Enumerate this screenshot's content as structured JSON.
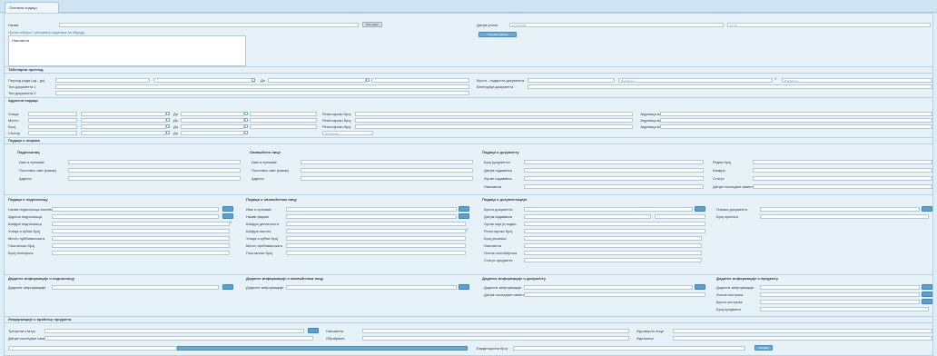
{
  "tab_label": "Основни подаци",
  "top": {
    "left_label": "Назив",
    "search_btn": "Претражи",
    "link_text": "Путем избора / уношења података за обраду",
    "textarea_text": "Напомена",
    "right_label": "Датум уноса",
    "right_value": "12.04.2018",
    "right_small": "10:15",
    "blue_btn": "Сачувај податке"
  },
  "tabular": {
    "title": "Табеларни преглед",
    "row1": "Период рада (од - до)",
    "mid_label": "До",
    "row2": "Тип документа 1",
    "row3": "Тип документа 2",
    "right1": "Врста - подврста документа",
    "right2": "Категорија документа",
    "ph_a": "Изаберите...",
    "ph_b": "Изаберите..."
  },
  "address": {
    "title": "Адресни подаци",
    "rows": [
      "Улица",
      "Место",
      "Број",
      "Сектор"
    ],
    "mid": "До",
    "reg_label": "Регистарски број",
    "right_label": "Јединица мере",
    "extra_ph": "Напомена..."
  },
  "columns": {
    "title": "Подаци о лицима",
    "c1": {
      "title": "Подносилац",
      "rows": [
        "Име и презиме",
        "Пословно име (назив)",
        "Адреса"
      ]
    },
    "c2": {
      "title": "Овлашћено лице",
      "rows": [
        "Име и презиме",
        "Пословно име (назив)",
        "Адреса"
      ]
    },
    "c3": {
      "title": "Подаци о документу",
      "rows": [
        "Број документа",
        "Датум издавања",
        "Орган издавања",
        "Напомена"
      ]
    },
    "c4": {
      "rows": [
        "Редни број",
        "Шифра",
        "Статус",
        "Датум последње измене"
      ]
    }
  },
  "lower": {
    "l1": {
      "title": "Подаци о подносиоцу",
      "rows": [
        "Назив подносиоца захтева",
        "Адреса подносиоца",
        "Шифра подносиоца",
        "Улица и кућни број",
        "Место пребивалишта",
        "Поштански број",
        "Број телефона"
      ]
    },
    "l2": {
      "title": "Подаци о овлашћеном лицу",
      "rows": [
        "Име и презиме",
        "Назив фирме",
        "Шифра делатности",
        "Шифра налога",
        "Улица и кућни број",
        "Место пребивалишта",
        "Поштански број"
      ]
    },
    "l3": {
      "title": "Подаци о документацији",
      "rows": [
        "Врста документа",
        "Датум издавања",
        "Орган који је издао",
        "Регистарски број",
        "Број решења",
        "Напомена",
        "Основ ослобођења",
        "Статус предмета"
      ]
    },
    "l4": {
      "rows": [
        "Ознака документа",
        "Број прилога"
      ]
    }
  },
  "bottom_sections": {
    "s1": {
      "title": "Додатне информације о подносиоцу",
      "row": "Додатне информације"
    },
    "s2": {
      "title": "Додатне информације о овлашћеном лицу",
      "row": "Додатне информације"
    },
    "s3": {
      "title": "Додатне информације о документу",
      "rows": [
        "Додатне информације",
        "Датум последње измене"
      ]
    },
    "s4": {
      "title": "Додатне информације о предмету",
      "rows": [
        "Додатне информације",
        "Основ поступка",
        "Врста поступка",
        "Број предмета"
      ]
    }
  },
  "final": {
    "title": "Информације о праћењу предмета",
    "left": [
      "Тренутни статус",
      "Датум последње измене"
    ],
    "mid": [
      "Напомена",
      "Обрађивач"
    ],
    "right": [
      "Одговорно лице",
      "Одељење"
    ],
    "bottom_label": "Евиденциони број",
    "bottom_btn_label": "Сачувај",
    "search_btn_label": "Додај"
  },
  "colors": {
    "accent": "#5aa0d4",
    "bg": "#e6f1f8"
  }
}
